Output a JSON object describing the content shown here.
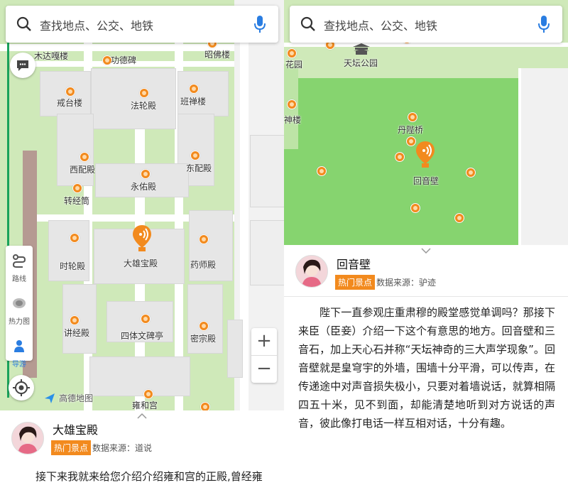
{
  "search": {
    "placeholder": "查找地点、公交、地铁"
  },
  "left": {
    "map_labels": {
      "lama": "木达嘎楼",
      "gongde": "功德碑",
      "zhaozhuan": "昭佛楼",
      "jietai": "戒台楼",
      "falun": "法轮殿",
      "banchan": "班禅楼",
      "xipei": "西配殿",
      "dongpei": "东配殿",
      "yongyou": "永佑殿",
      "zhuanjing": "转经筒",
      "shilun": "时轮殿",
      "daxiong": "大雄宝殿",
      "yaoshi": "药师殿",
      "jiangjing": "讲经殿",
      "sitiwen": "四体文碑亭",
      "mizong": "密宗殿",
      "gate": "雍和宫",
      "logo": "高德地图"
    },
    "controls": {
      "route": "路线",
      "heat": "热力图",
      "guide": "导游",
      "zoom_in": "+",
      "zoom_out": "−"
    },
    "card": {
      "name": "大雄宝殿",
      "tag": "热门景点",
      "source": "数据来源：道说",
      "body": "接下来我就来给您介绍介绍雍和宫的正殿,曾经雍"
    }
  },
  "right": {
    "map_labels": {
      "tianyu": "天坛公园",
      "huayuan": "花园",
      "shenyue": "神楼",
      "danbi": "丹陛桥",
      "huiyin": "回音壁"
    },
    "card": {
      "name": "回音壁",
      "tag": "热门景点",
      "source": "数据来源：驴迹",
      "body": "陛下一直参观庄重肃穆的殿堂感觉单调吗？那接下来臣（臣妾）介绍一下这个有意思的地方。回音壁和三音石，加上天心石并称“天坛神奇的三大声学现象”。回音壁就是皇穹宇的外墙，围墙十分平滑，可以传声，在传递途中对声音损失极小，只要对着墙说话，就算相隔四五十米，见不到面，却能清楚地听到对方说话的声音，彼此像打电话一样互相对话，十分有趣。"
    }
  },
  "colors": {
    "accent": "#f28a1e",
    "mic": "#2a7de1",
    "grass": "#cfe9b9",
    "park": "#86d46f"
  }
}
